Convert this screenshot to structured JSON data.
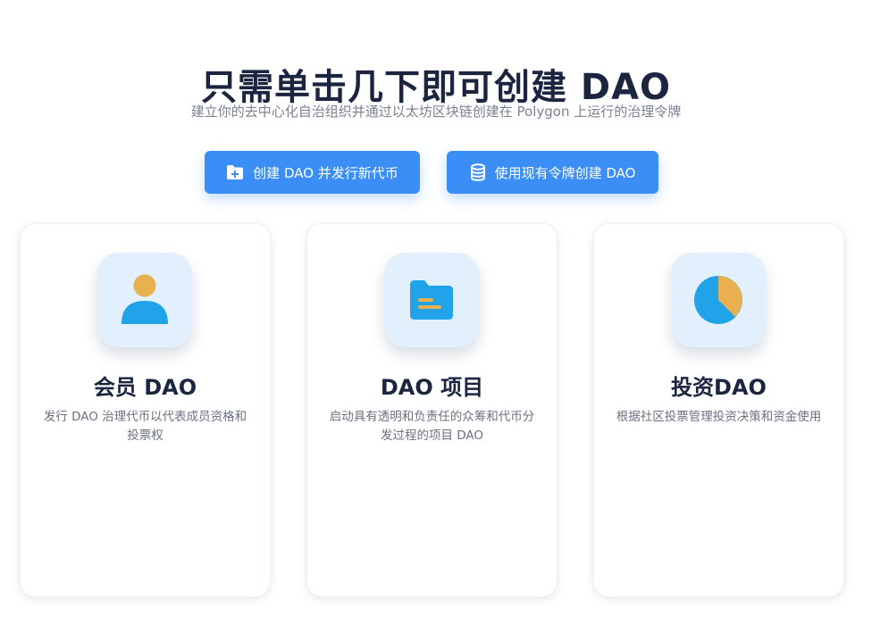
{
  "hero": {
    "title": "只需单击几下即可创建 DAO",
    "subtitle": "建立你的去中心化自治组织并通过以太坊区块链创建在 Polygon 上运行的治理令牌"
  },
  "actions": {
    "create_new_token": {
      "label": "创建 DAO 并发行新代币",
      "icon": "folder-plus-icon"
    },
    "use_existing_token": {
      "label": "使用现有令牌创建 DAO",
      "icon": "database-icon"
    }
  },
  "cards": [
    {
      "title": "会员 DAO",
      "description": "发行 DAO 治理代币以代表成员资格和投票权",
      "icon": "member-icon"
    },
    {
      "title": "DAO 项目",
      "description": "启动具有透明和负责任的众筹和代币分发过程的项目 DAO",
      "icon": "folder-icon"
    },
    {
      "title": "投资DAO",
      "description": "根据社区投票管理投资决策和资金使用",
      "icon": "pie-chart-icon"
    }
  ],
  "colors": {
    "primary": "#3a8ef6",
    "icon_blue": "#21a3ea",
    "icon_orange": "#e8b04f",
    "tile_bg": "#e2f0fd",
    "title_text": "#1b2540"
  }
}
